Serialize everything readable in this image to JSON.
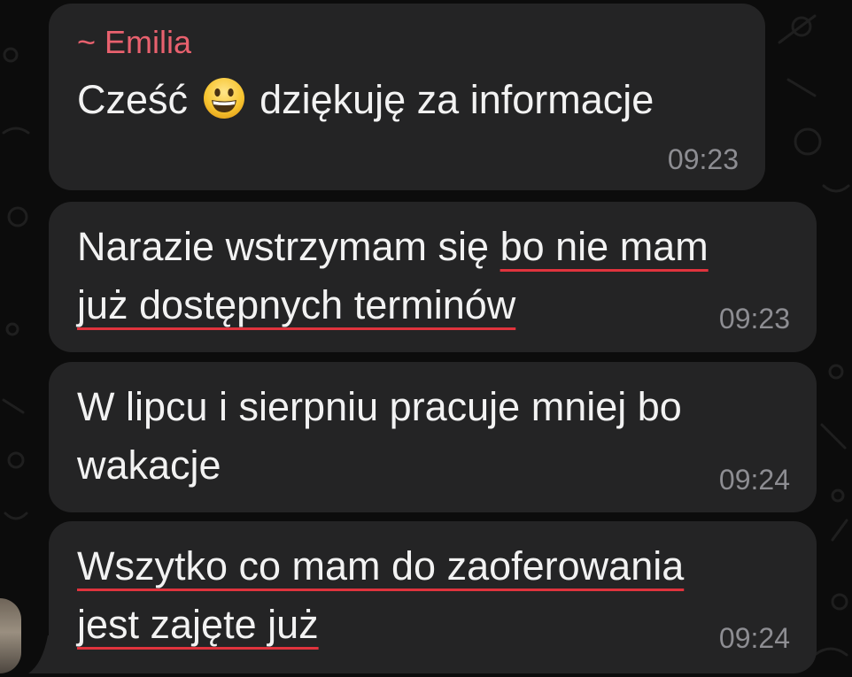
{
  "colors": {
    "background": "#0c0c0c",
    "bubble": "#242425",
    "sender_name": "#e8616e",
    "message_text": "#f2f2f2",
    "timestamp": "#8d8d92",
    "spellcheck_underline": "#e0333d"
  },
  "messages": [
    {
      "sender": "~ Emilia",
      "text_before_emoji": "Cześć",
      "emoji": "grinning-face-emoji",
      "text_after_emoji": "dziękuję za informacje",
      "time": "09:23"
    },
    {
      "line1_plain": "Narazie wstrzymam się ",
      "line1_underlined": "bo nie mam",
      "line2_underlined": "już dostępnych terminów",
      "time": "09:23"
    },
    {
      "line1": "W lipcu i sierpniu pracuje mniej bo",
      "line2": "wakacje",
      "time": "09:24"
    },
    {
      "line1_underlined": "Wszytko co mam do zaoferowania",
      "line2_underlined": "jest zajęte już",
      "time": "09:24"
    }
  ]
}
